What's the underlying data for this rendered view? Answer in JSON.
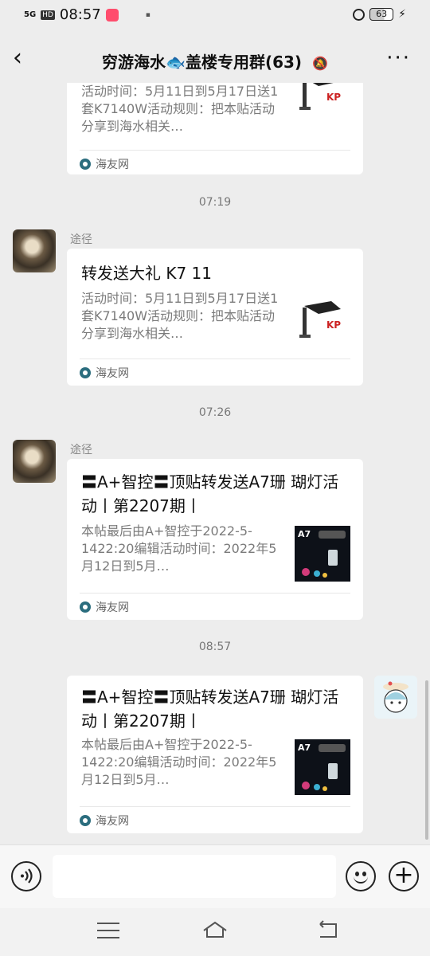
{
  "status_bar": {
    "network": "5G",
    "hd": "HD",
    "time": "08:57",
    "battery": "63"
  },
  "header": {
    "title": "穷游海水🐟盖楼专用群(63)",
    "mute_icon": "bell-off-icon",
    "more": "···"
  },
  "messages": [
    {
      "sender": "",
      "title": "",
      "desc": "活动时间：5月11日到5月17日送1套K7140W活动规则：把本贴活动分享到海水相关…",
      "source": "海友网",
      "thumb_brand": "KP"
    },
    {
      "time": "07:19",
      "sender": "途径",
      "title": "转发送大礼 K7 11",
      "desc": "活动时间：5月11日到5月17日送1套K7140W活动规则：把本贴活动分享到海水相关…",
      "source": "海友网",
      "thumb_brand": "KP"
    },
    {
      "time": "07:26",
      "sender": "途径",
      "title": "〓A+智控〓顶贴转发送A7珊 瑚灯活动丨第2207期丨",
      "desc": "本帖最后由A+智控于2022-5-1422:20编辑活动时间：2022年5月12日到5月…",
      "source": "海友网",
      "thumb_brand": "A7"
    },
    {
      "time": "08:57",
      "sender": "",
      "title": "〓A+智控〓顶贴转发送A7珊 瑚灯活动丨第2207期丨",
      "desc": "本帖最后由A+智控于2022-5-1422:20编辑活动时间：2022年5月12日到5月…",
      "source": "海友网",
      "thumb_brand": "A7"
    }
  ],
  "input": {
    "value": "",
    "voice_icon": "voice-icon",
    "emoji_icon": "emoji-icon",
    "plus_icon": "plus-icon"
  },
  "colors": {
    "chat_bg": "#ededed",
    "card_bg": "#ffffff",
    "source_icon": "#2b6d7e"
  }
}
